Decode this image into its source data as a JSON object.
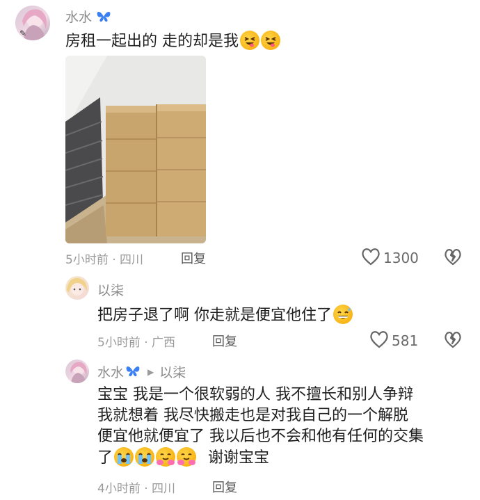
{
  "comments": [
    {
      "user": "水水",
      "text_segments": [
        "房租一起出的 走的却是我"
      ],
      "emojis": [
        "laughing-tongue-emoji",
        "laughing-tongue-emoji"
      ],
      "time_location": "5小时前 · 四川",
      "reply_label": "回复",
      "like_count": "1300"
    },
    {
      "user": "以柒",
      "text": "把房子退了啊 你走就是便宜他住了",
      "emoji": "sweat-smile-emoji",
      "time_location": "5小时前 · 广西",
      "reply_label": "回复",
      "like_count": "581"
    },
    {
      "user": "水水",
      "reply_to": "以柒",
      "lines": [
        "宝宝 我是一个很软弱的人 我不擅长和别人争辩",
        "我就想着 我尽快搬走也是对我自己的一个解脱",
        "便宜他就便宜了 我以后也不会和他有任何的交集",
        "了"
      ],
      "tail_text": "谢谢宝宝",
      "emojis": [
        "loudly-crying-emoji",
        "loudly-crying-emoji",
        "hugging-emoji",
        "hugging-emoji"
      ],
      "time_location": "4小时前 · 四川",
      "reply_label": "回复"
    }
  ],
  "colors": {
    "text": "#1f1f1f",
    "meta": "#9a9a9a",
    "name": "#8b8b8b",
    "butterfly": "#3b7ff0"
  }
}
